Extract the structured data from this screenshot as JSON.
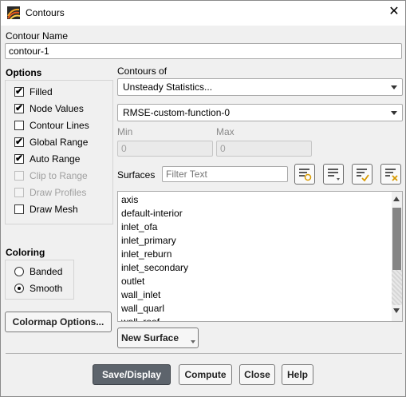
{
  "window": {
    "title": "Contours"
  },
  "contour_name": {
    "label": "Contour Name",
    "value": "contour-1"
  },
  "options": {
    "label": "Options",
    "items": [
      {
        "label": "Filled",
        "checked": true,
        "enabled": true
      },
      {
        "label": "Node Values",
        "checked": true,
        "enabled": true
      },
      {
        "label": "Contour Lines",
        "checked": false,
        "enabled": true
      },
      {
        "label": "Global Range",
        "checked": true,
        "enabled": true
      },
      {
        "label": "Auto Range",
        "checked": true,
        "enabled": true
      },
      {
        "label": "Clip to Range",
        "checked": false,
        "enabled": false
      },
      {
        "label": "Draw Profiles",
        "checked": false,
        "enabled": false
      },
      {
        "label": "Draw Mesh",
        "checked": false,
        "enabled": true
      }
    ]
  },
  "coloring": {
    "label": "Coloring",
    "items": [
      {
        "label": "Banded",
        "selected": false
      },
      {
        "label": "Smooth",
        "selected": true
      }
    ]
  },
  "colormap_button": "Colormap Options...",
  "contours_of": {
    "label": "Contours of",
    "category": "Unsteady Statistics...",
    "field": "RMSE-custom-function-0"
  },
  "range": {
    "min_label": "Min",
    "min_value": "0",
    "max_label": "Max",
    "max_value": "0"
  },
  "surfaces": {
    "label": "Surfaces",
    "filter_placeholder": "Filter Text",
    "items": [
      "axis",
      "default-interior",
      "inlet_ofa",
      "inlet_primary",
      "inlet_reburn",
      "inlet_secondary",
      "outlet",
      "wall_inlet",
      "wall_quarl",
      "wall_roof"
    ]
  },
  "new_surface_button": "New Surface",
  "buttons": {
    "save_display": "Save/Display",
    "compute": "Compute",
    "close": "Close",
    "help": "Help"
  },
  "icons": [
    "contours-app-icon",
    "close-icon",
    "filter-select-icon",
    "list-menu-icon",
    "select-all-icon",
    "deselect-all-icon"
  ]
}
